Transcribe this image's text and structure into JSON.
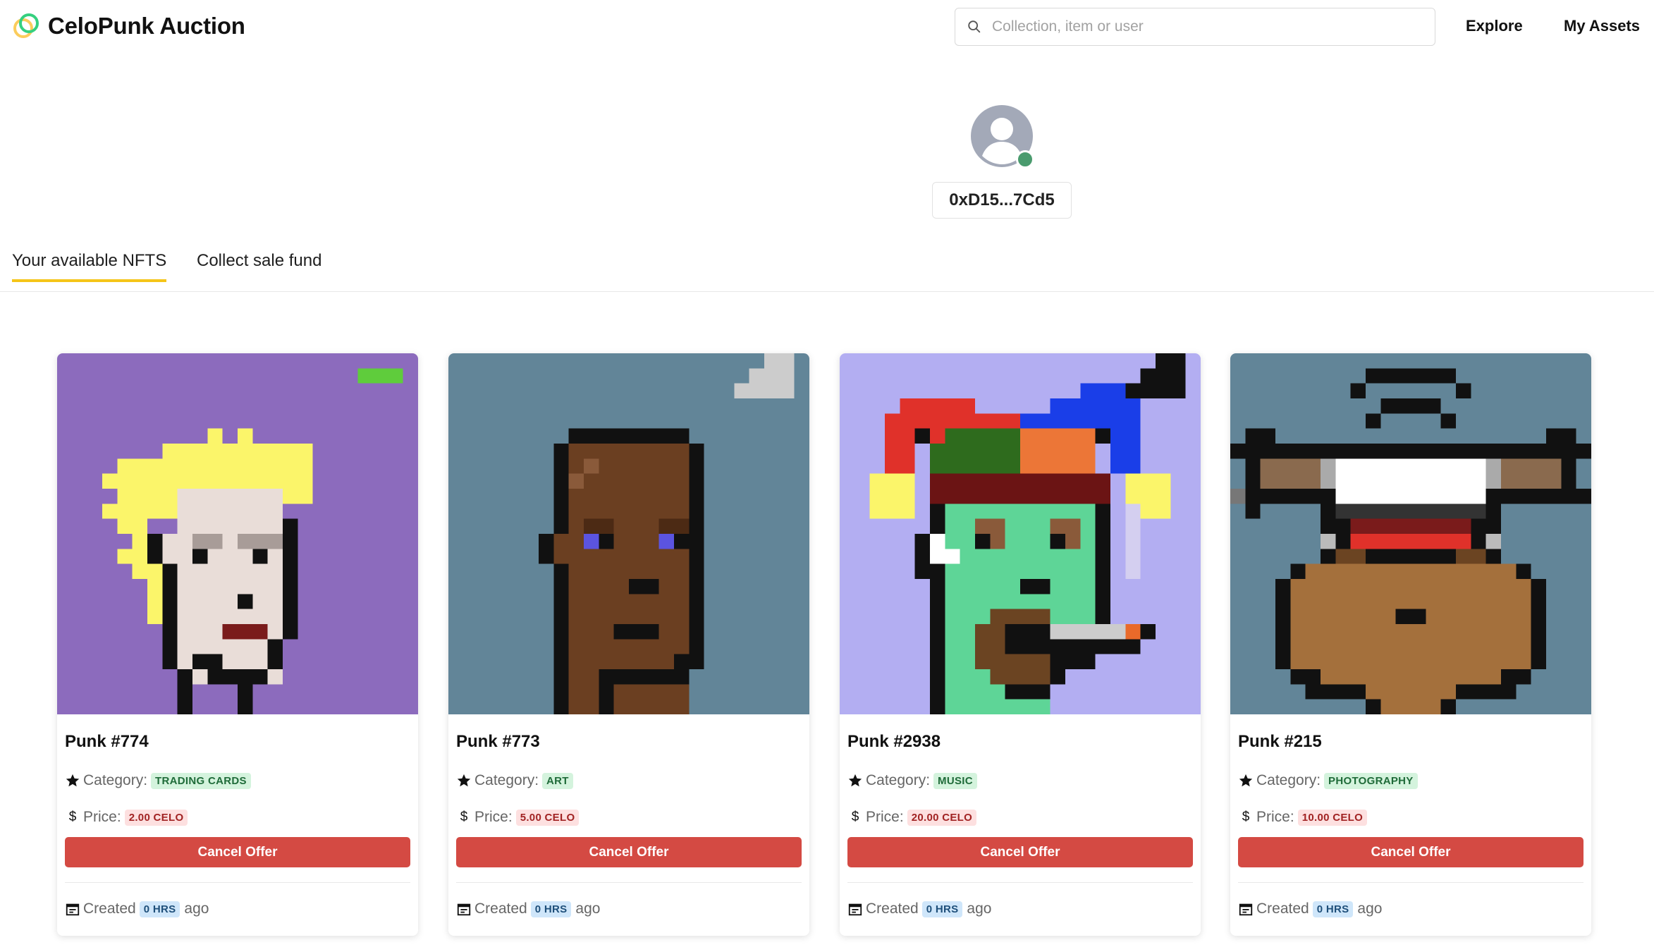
{
  "app": {
    "title": "CeloPunk Auction",
    "accent_color": "#f5c518",
    "logo_colors": [
      "#35d07f",
      "#fbcc5c"
    ]
  },
  "search": {
    "placeholder": "Collection, item or user",
    "value": ""
  },
  "nav": {
    "explore": "Explore",
    "my_assets": "My Assets"
  },
  "profile": {
    "address": "0xD15...7Cd5",
    "status_color": "#4a9b6e"
  },
  "tabs": [
    {
      "label": "Your available NFTS",
      "active": true
    },
    {
      "label": "Collect sale fund",
      "active": false
    }
  ],
  "labels": {
    "category": "Category:",
    "price": "Price:",
    "created": "Created",
    "ago": "ago",
    "cancel": "Cancel Offer"
  },
  "cards": [
    {
      "title": "Punk #774",
      "category": "TRADING CARDS",
      "price": "2.00 CELO",
      "created": "0 HRS",
      "bg_color": "#8c6bbd"
    },
    {
      "title": "Punk #773",
      "category": "ART",
      "price": "5.00 CELO",
      "created": "0 HRS",
      "bg_color": "#628598"
    },
    {
      "title": "Punk #2938",
      "category": "MUSIC",
      "price": "20.00 CELO",
      "created": "0 HRS",
      "bg_color": "#b3aef2"
    },
    {
      "title": "Punk #215",
      "category": "PHOTOGRAPHY",
      "price": "10.00 CELO",
      "created": "0 HRS",
      "bg_color": "#628598"
    }
  ]
}
